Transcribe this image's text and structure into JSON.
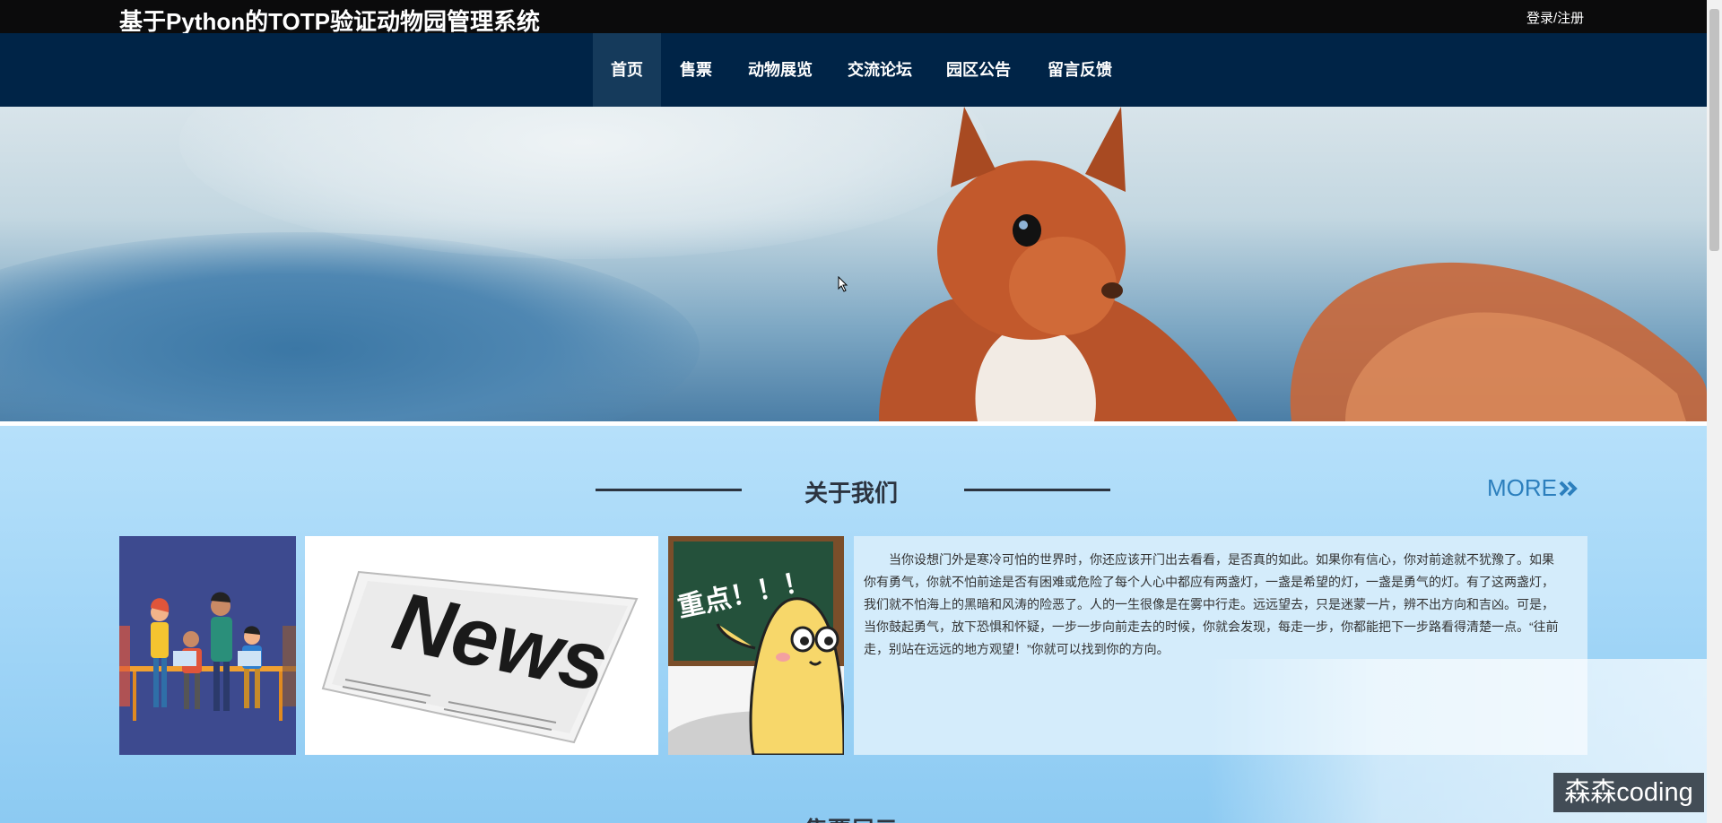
{
  "header": {
    "title": "基于Python的TOTP验证动物园管理系统",
    "login_label": "登录/注册"
  },
  "nav": {
    "items": [
      {
        "label": "首页",
        "active": true
      },
      {
        "label": "售票",
        "active": false
      },
      {
        "label": "动物展览",
        "active": false
      },
      {
        "label": "交流论坛",
        "active": false
      },
      {
        "label": "园区公告",
        "active": false
      },
      {
        "label": "留言反馈",
        "active": false
      }
    ]
  },
  "banner": {
    "slide_count": 3,
    "active_slide": 2,
    "image_icon": "squirrel-photo"
  },
  "about": {
    "title": "关于我们",
    "more_label": "MORE",
    "more_icon": "double-chevron-right-icon",
    "text": "当你设想门外是寒冷可怕的世界时，你还应该开门出去看看，是否真的如此。如果你有信心，你对前途就不犹豫了。如果你有勇气，你就不怕前途是否有困难或危险了每个人心中都应有两盏灯，一盏是希望的灯，一盏是勇气的灯。有了这两盏灯，我们就不怕海上的黑暗和风涛的险恶了。人的一生很像是在雾中行走。远远望去，只是迷蒙一片，辨不出方向和吉凶。可是，当你鼓起勇气，放下恐惧和怀疑，一步一步向前走去的时候，你就会发现，每走一步，你都能把下一步路看得清楚一点。“往前走，别站在远远的地方观望！”你就可以找到你的方向。",
    "images": [
      {
        "name": "team-illustration"
      },
      {
        "name": "news-newspaper"
      },
      {
        "name": "chalkboard-mascot",
        "caption": "重点！！！"
      }
    ],
    "news_word": "News"
  },
  "next_section": {
    "title": "售票展示"
  },
  "watermark": "森森coding",
  "colors": {
    "topbar": "#0b0b0c",
    "navbar": "#002447",
    "nav_active": "#153a5b",
    "accent_dot": "#e8562a",
    "more_link": "#2c7fbd"
  }
}
